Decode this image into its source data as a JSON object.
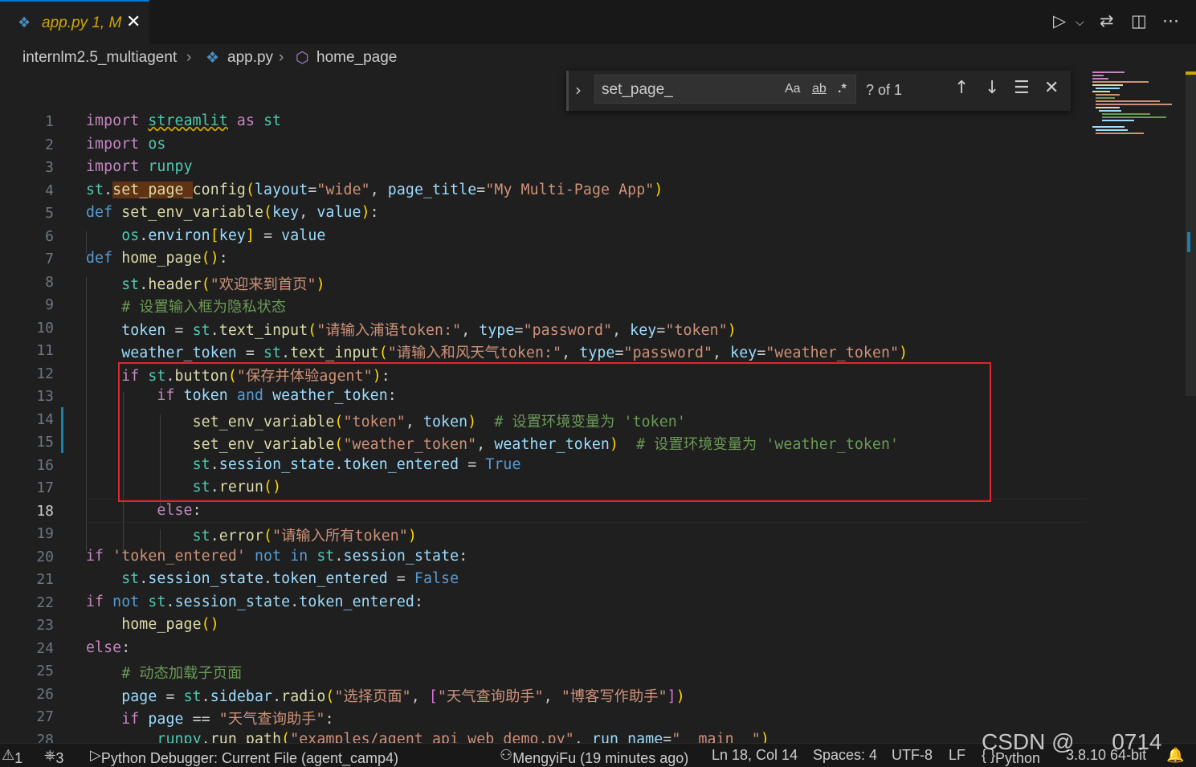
{
  "tab": {
    "filename": "app.py",
    "status": "1, M",
    "icon": "python-icon"
  },
  "breadcrumb": {
    "folder": "internlm2.5_multiagent",
    "file": "app.py",
    "symbol": "home_page"
  },
  "find": {
    "query": "set_page_",
    "match_case": "Aa",
    "whole_word": "ab",
    "regex": ".*",
    "count": "? of 1"
  },
  "editor": {
    "active_line": 18
  },
  "status": {
    "errors": "1",
    "ports": "3",
    "debug": "Python Debugger: Current File (agent_camp4)",
    "blame": "MengyiFu (19 minutes ago)",
    "position": "Ln 18, Col 14",
    "spaces": "Spaces: 4",
    "encoding": "UTF-8",
    "eol": "LF",
    "language": "Python",
    "interpreter": "3.8.10 64-bit"
  },
  "watermark": "CSDN @      0714",
  "colors": {
    "accent": "#0078d4",
    "highlight_box": "#e0262f",
    "modified_tab": "#cca700"
  }
}
